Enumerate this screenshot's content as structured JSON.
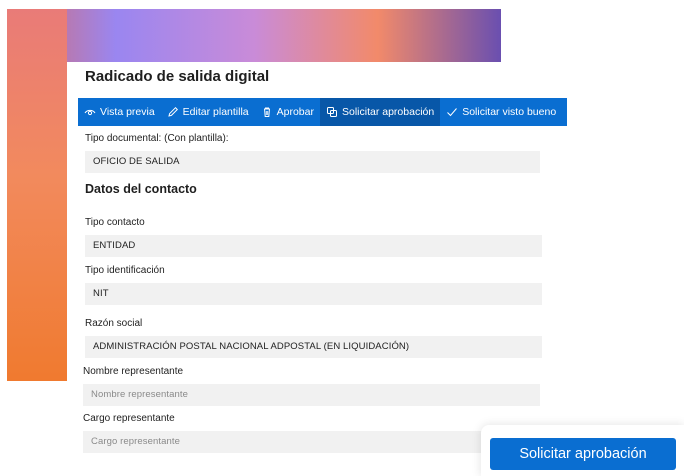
{
  "page_title": "Radicado de salida digital",
  "toolbar": {
    "items": [
      {
        "label": "Vista previa",
        "icon": "eye-icon"
      },
      {
        "label": "Editar plantilla",
        "icon": "pencil-icon"
      },
      {
        "label": "Aprobar",
        "icon": "trash-icon"
      },
      {
        "label": "Solicitar aprobación",
        "icon": "copy-icon"
      },
      {
        "label": "Solicitar visto bueno",
        "icon": "check-icon"
      }
    ],
    "active_index": 3
  },
  "form": {
    "tipo_documental_label": "Tipo documental: (Con plantilla):",
    "tipo_documental_value": "OFICIO DE SALIDA",
    "section_contacto": "Datos del contacto",
    "tipo_contacto_label": "Tipo contacto",
    "tipo_contacto_value": "ENTIDAD",
    "tipo_identificacion_label": "Tipo identificación",
    "tipo_identificacion_value": "NIT",
    "razon_social_label": "Razón social",
    "razon_social_value": "ADMINISTRACIÓN POSTAL NACIONAL ADPOSTAL (EN LIQUIDACIÓN)",
    "nombre_representante_label": "Nombre representante",
    "nombre_representante_placeholder": "Nombre representante",
    "cargo_representante_label": "Cargo representante",
    "cargo_representante_placeholder": "Cargo representante"
  },
  "floating_button": {
    "label": "Solicitar aprobación"
  },
  "colors": {
    "toolbar_bg": "#0a6ed1",
    "toolbar_active_bg": "#0857a8",
    "field_bg": "#f1f1f1"
  }
}
